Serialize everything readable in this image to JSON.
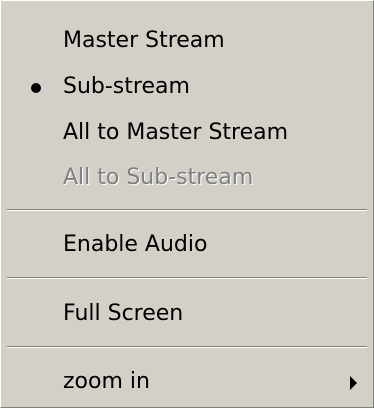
{
  "menu": {
    "items": [
      {
        "label": "Master Stream",
        "selected": false,
        "disabled": false
      },
      {
        "label": "Sub-stream",
        "selected": true,
        "disabled": false
      },
      {
        "label": "All to Master Stream",
        "selected": false,
        "disabled": false
      },
      {
        "label": "All to Sub-stream",
        "selected": false,
        "disabled": true
      },
      {
        "label": "Enable Audio",
        "selected": false,
        "disabled": false
      },
      {
        "label": "Full Screen",
        "selected": false,
        "disabled": false
      },
      {
        "label": "zoom in",
        "selected": false,
        "disabled": false,
        "has_submenu": true
      }
    ]
  },
  "colors": {
    "menu_background": "#d4d0c8",
    "text": "#000000",
    "disabled_text": "#808080",
    "highlight": "#ffffff",
    "shadow": "#808080"
  },
  "icons": {
    "selected_marker": "bullet-icon",
    "submenu_indicator": "submenu-arrow-icon"
  }
}
